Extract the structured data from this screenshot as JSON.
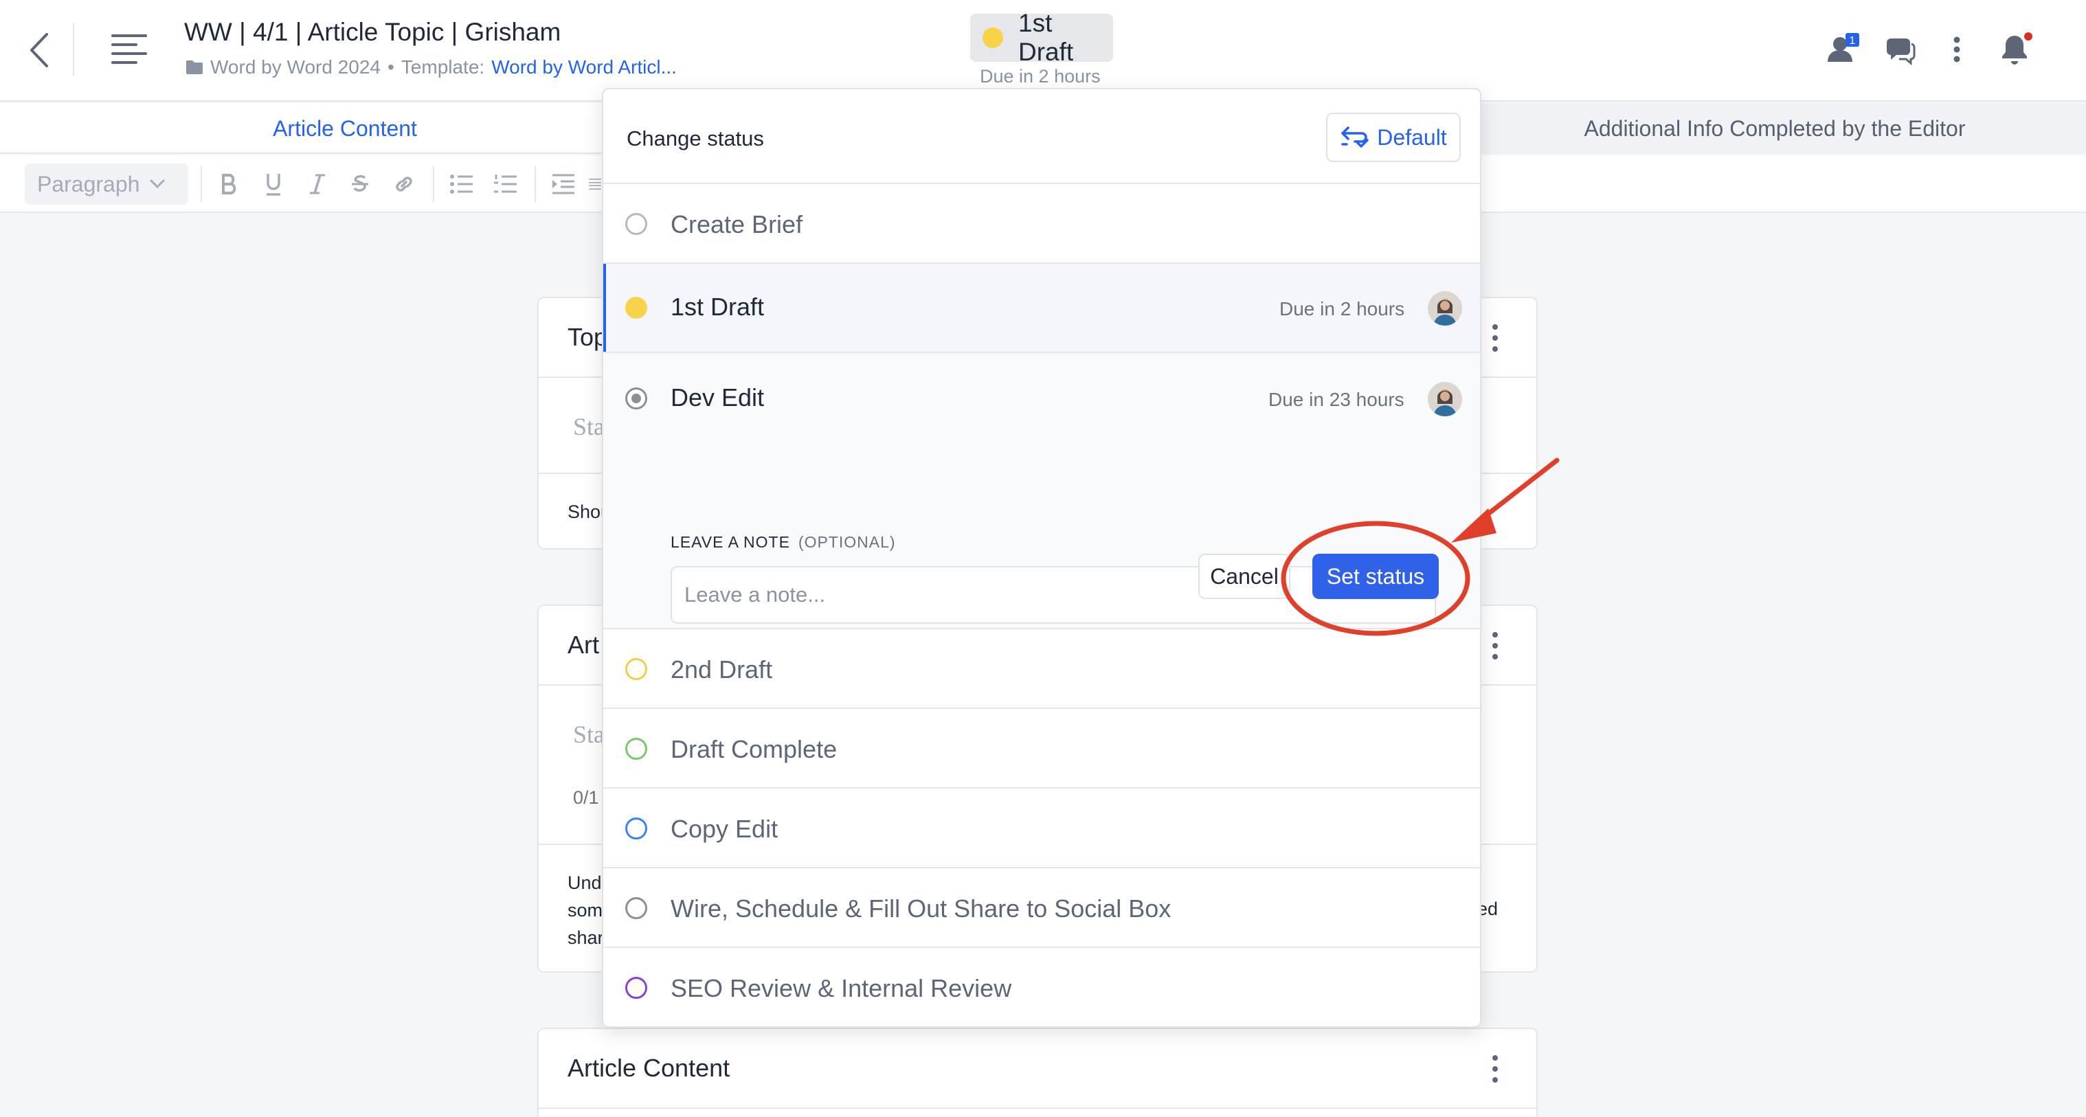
{
  "header": {
    "title": "WW | 4/1 | Article Topic | Grisham",
    "folder": "Word by Word 2024",
    "template_label": "Template:",
    "template_link": "Word by Word Articl...",
    "status": {
      "label": "1st Draft",
      "due": "Due in 2 hours",
      "color": "#f8d34a"
    },
    "assignee_badge": "1"
  },
  "tabs": {
    "left": "Article Content",
    "right": "Additional Info Completed by the Editor"
  },
  "toolbar": {
    "paragraph_label": "Paragraph"
  },
  "cards": [
    {
      "title": "Top",
      "placeholder": "Sta",
      "footer": "Shou"
    },
    {
      "title": "Art",
      "placeholder": "Sta",
      "counter": "0/1",
      "lines": [
        "Und",
        "som",
        "shar"
      ],
      "right_fragment": "ed"
    },
    {
      "title": "Article Content"
    }
  ],
  "dropdown": {
    "title": "Change status",
    "default_label": "Default",
    "statuses": [
      {
        "label": "Create Brief",
        "color": "#b4bac4",
        "style": "ring"
      },
      {
        "label": "1st Draft",
        "color": "#f8d34a",
        "style": "filled",
        "due": "Due in 2 hours",
        "active": true
      },
      {
        "label": "Dev Edit",
        "color": "#8a8f98",
        "style": "radio",
        "due": "Due in 23 hours",
        "expanded": true
      },
      {
        "label": "2nd Draft",
        "color": "#f2cf47",
        "style": "ring"
      },
      {
        "label": "Draft Complete",
        "color": "#7ac86b",
        "style": "ring"
      },
      {
        "label": "Copy Edit",
        "color": "#3b82f6",
        "style": "ring"
      },
      {
        "label": "Wire, Schedule & Fill Out Share to Social Box",
        "color": "#8a8f98",
        "style": "ring"
      },
      {
        "label": "SEO Review & Internal Review",
        "color": "#8b3fd9",
        "style": "ring"
      }
    ],
    "note": {
      "label": "LEAVE A NOTE",
      "optional": "(OPTIONAL)",
      "placeholder": "Leave a note...",
      "cancel_label": "Cancel",
      "submit_label": "Set status"
    }
  },
  "annotation_color": "#e0402a"
}
